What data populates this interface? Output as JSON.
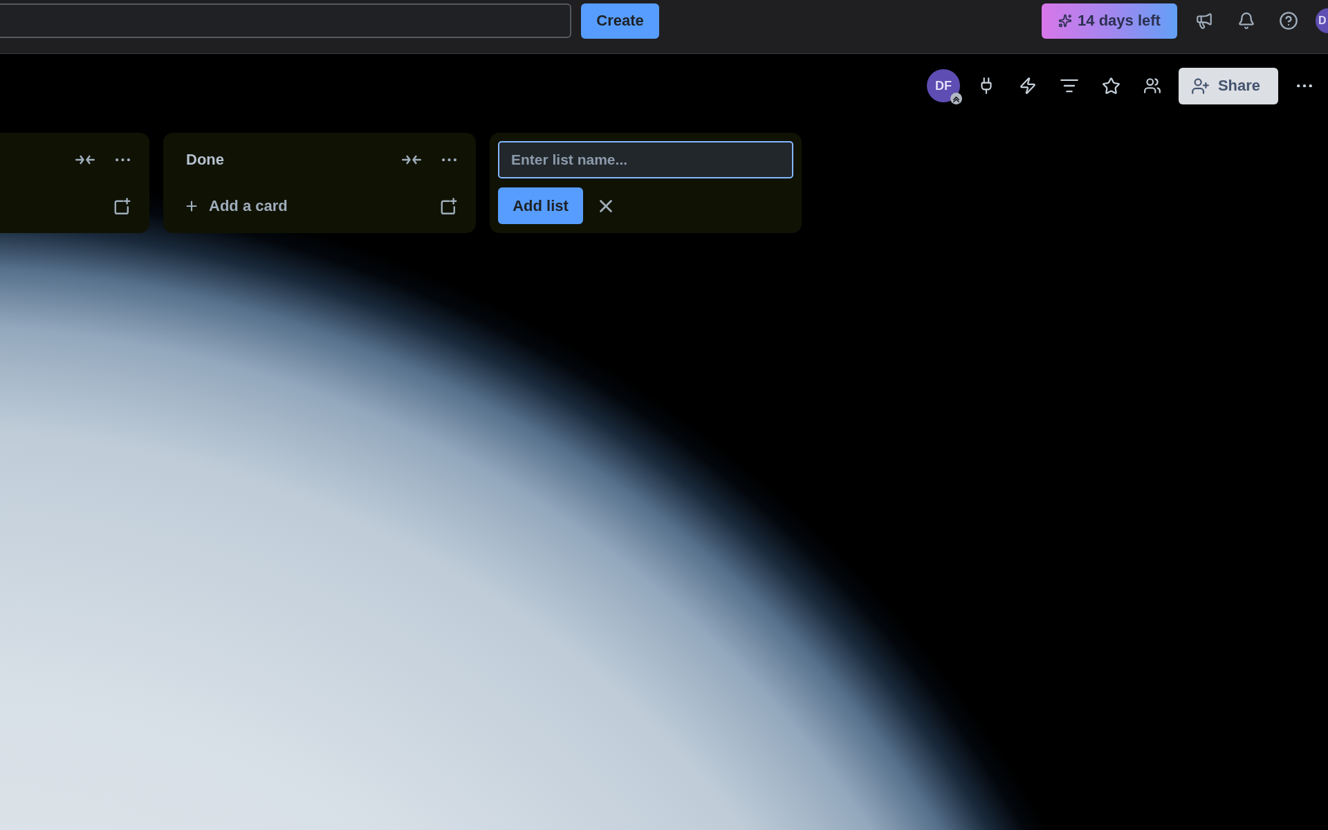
{
  "top_bar": {
    "create_button": "Create",
    "trial_badge": "14 days left",
    "account_avatar": "D"
  },
  "board_header": {
    "member_avatar": "DF",
    "share_button": "Share"
  },
  "lists": [
    {
      "kind": "list"
    },
    {
      "kind": "list",
      "title": "Done",
      "add_card": "Add a card"
    },
    {
      "kind": "add_list_form",
      "placeholder": "Enter list name...",
      "submit_button": "Add list"
    }
  ]
}
